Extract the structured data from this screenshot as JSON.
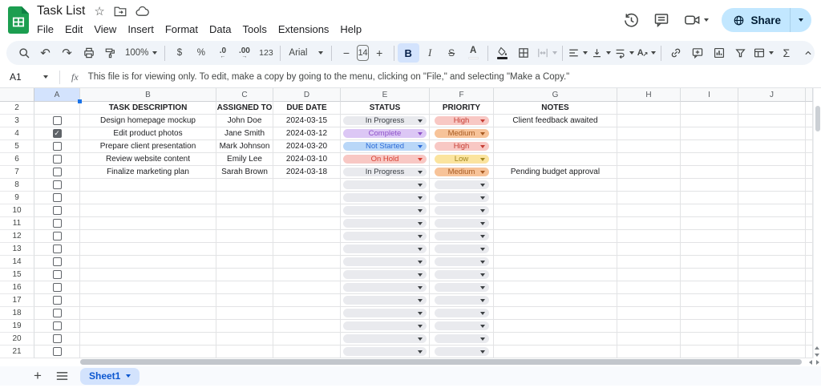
{
  "app": {
    "title": "Task List",
    "menus": [
      "File",
      "Edit",
      "View",
      "Insert",
      "Format",
      "Data",
      "Tools",
      "Extensions",
      "Help"
    ]
  },
  "topbar": {
    "share_label": "Share",
    "icon_names": [
      "version-history-icon",
      "comments-icon",
      "video-call-icon",
      "globe-icon",
      "star-icon",
      "move-folder-icon",
      "cloud-saved-icon"
    ]
  },
  "toolbar": {
    "zoom": "100%",
    "font_family_label": "Arial",
    "font_size": "14",
    "currency": "$",
    "percent": "%",
    "dec_decrease": ".0",
    "dec_increase": ".00",
    "more_formats": "123",
    "bold": "B",
    "italic": "I",
    "strikethrough": "S",
    "text_color": "A",
    "undo_glyph": "↶",
    "redo_glyph": "↷",
    "minus": "−",
    "plus": "+",
    "sigma": "Σ",
    "rotation_letter": "A",
    "rotation_arrow": "↗"
  },
  "formula_bar": {
    "cell_ref": "A1",
    "fx_label": "fx",
    "message": "This file is for viewing only. To edit, make a copy by going to the menu, clicking on \"File,\" and selecting \"Make a Copy.\""
  },
  "grid": {
    "selected_cell": "A1",
    "selected_column": "A",
    "first_visible_row": 2,
    "last_visible_row": 21,
    "gutter_width": 43,
    "columns": [
      {
        "letter": "A",
        "width": 57
      },
      {
        "letter": "B",
        "width": 170
      },
      {
        "letter": "C",
        "width": 71
      },
      {
        "letter": "D",
        "width": 84
      },
      {
        "letter": "E",
        "width": 111
      },
      {
        "letter": "F",
        "width": 80
      },
      {
        "letter": "G",
        "width": 154
      },
      {
        "letter": "H",
        "width": 79
      },
      {
        "letter": "I",
        "width": 72
      },
      {
        "letter": "J",
        "width": 84
      },
      {
        "letter": "",
        "width": 9
      }
    ],
    "header_row": {
      "row": 2,
      "labels": {
        "B": "TASK DESCRIPTION",
        "C": "ASSIGNED TO",
        "D": "DUE DATE",
        "E": "STATUS",
        "F": "PRIORITY",
        "G": "NOTES"
      }
    },
    "tasks": [
      {
        "row": 3,
        "checked": false,
        "description": "Design homepage mockup",
        "assignee": "John Doe",
        "due": "2024-03-15",
        "status": "In Progress",
        "priority": "High",
        "notes": "Client feedback awaited"
      },
      {
        "row": 4,
        "checked": true,
        "description": "Edit product photos",
        "assignee": "Jane Smith",
        "due": "2024-03-12",
        "status": "Complete",
        "priority": "Medium",
        "notes": ""
      },
      {
        "row": 5,
        "checked": false,
        "description": "Prepare client presentation",
        "assignee": "Mark Johnson",
        "due": "2024-03-20",
        "status": "Not Started",
        "priority": "High",
        "notes": ""
      },
      {
        "row": 6,
        "checked": false,
        "description": "Review website content",
        "assignee": "Emily Lee",
        "due": "2024-03-10",
        "status": "On Hold",
        "priority": "Low",
        "notes": ""
      },
      {
        "row": 7,
        "checked": false,
        "description": "Finalize marketing plan",
        "assignee": "Sarah Brown",
        "due": "2024-03-18",
        "status": "In Progress",
        "priority": "Medium",
        "notes": "Pending budget approval"
      }
    ],
    "empty_row_range": [
      8,
      21
    ],
    "status_styles": {
      "In Progress": {
        "bg": "#e9eaee",
        "fg": "#3b4045"
      },
      "Complete": {
        "bg": "#dcc7f5",
        "fg": "#8c50c8"
      },
      "Not Started": {
        "bg": "#b9d7f8",
        "fg": "#2c6cd8"
      },
      "On Hold": {
        "bg": "#f8c8c4",
        "fg": "#d63e31"
      }
    },
    "priority_styles": {
      "High": {
        "bg": "#f8c8c4",
        "fg": "#c63d34"
      },
      "Medium": {
        "bg": "#f7c399",
        "fg": "#a85b22"
      },
      "Low": {
        "bg": "#fbe49f",
        "fg": "#a28620"
      }
    },
    "empty_chip": {
      "bg": "#e9eaee",
      "caret": "#3c4043"
    },
    "checkmark_glyph": "✓"
  },
  "footer": {
    "sheet_tab": "Sheet1"
  },
  "colors": {
    "accent_blue": "#0b57d0",
    "selection_handle_blue": "#1a73e8",
    "share_bg": "#c2e7ff",
    "toolbar_bg": "#f0f4f9",
    "selected_header_bg": "#d3e3fd",
    "logo_green": "#1c9e50",
    "logo_green_dark": "#0d8043"
  }
}
